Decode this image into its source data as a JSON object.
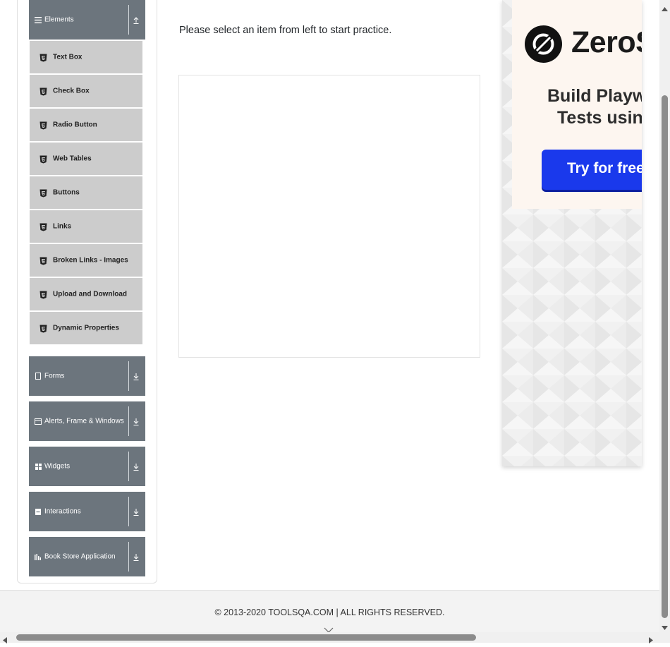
{
  "sidebar": {
    "elements_group": {
      "label": "Elements",
      "icon": "hamburger-icon",
      "state_icon": "collapse-up-icon"
    },
    "elements_items": [
      {
        "label": "Text Box",
        "icon": "html5-icon"
      },
      {
        "label": "Check Box",
        "icon": "html5-icon"
      },
      {
        "label": "Radio Button",
        "icon": "html5-icon"
      },
      {
        "label": "Web Tables",
        "icon": "html5-icon"
      },
      {
        "label": "Buttons",
        "icon": "html5-icon"
      },
      {
        "label": "Links",
        "icon": "html5-icon"
      },
      {
        "label": "Broken Links - Images",
        "icon": "html5-icon"
      },
      {
        "label": "Upload and Download",
        "icon": "html5-icon"
      },
      {
        "label": "Dynamic Properties",
        "icon": "html5-icon"
      }
    ],
    "other_groups": [
      {
        "label": "Forms",
        "icon": "form-icon",
        "state_icon": "expand-down-icon"
      },
      {
        "label": "Alerts, Frame & Windows",
        "icon": "window-icon",
        "state_icon": "expand-down-icon"
      },
      {
        "label": "Widgets",
        "icon": "grid-icon",
        "state_icon": "expand-down-icon"
      },
      {
        "label": "Interactions",
        "icon": "list-icon",
        "state_icon": "expand-down-icon"
      },
      {
        "label": "Book Store Application",
        "icon": "books-icon",
        "state_icon": "expand-down-icon"
      }
    ]
  },
  "main": {
    "intro_text": "Please select an item from left to start practice."
  },
  "ad": {
    "brand": "ZeroSt",
    "headline_line1": "Build Playwri",
    "headline_line2": "Tests using",
    "cta_label": "Try for free -"
  },
  "footer": {
    "copyright": "© 2013-2020 TOOLSQA.COM | ALL RIGHTS RESERVED."
  },
  "colors": {
    "group_header_bg": "#6c757d",
    "menu_item_bg": "#cccccc",
    "ad_cta_bg": "#1a39ec",
    "footer_bg": "#f3f3f3"
  }
}
